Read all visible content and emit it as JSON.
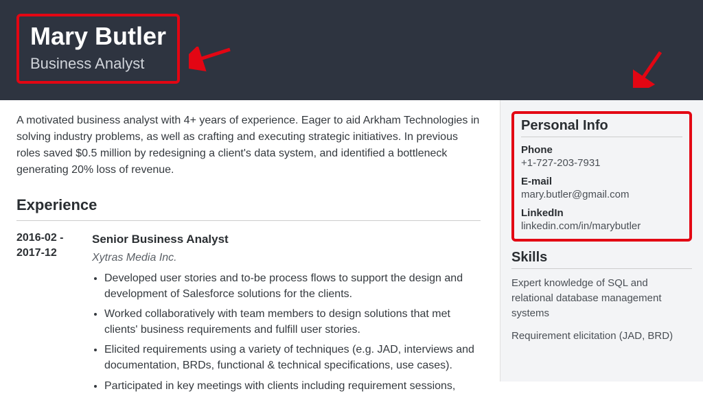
{
  "header": {
    "name": "Mary Butler",
    "title": "Business Analyst"
  },
  "summary": "A motivated business analyst with 4+ years of experience. Eager to aid Arkham Technologies in solving industry problems, as well as crafting and executing strategic initiatives. In previous roles saved $0.5 million by redesigning a client's data system, and identified a bottleneck generating 20% loss of revenue.",
  "sections": {
    "experience_heading": "Experience"
  },
  "experience": {
    "dates": "2016-02 - 2017-12",
    "title": "Senior Business Analyst",
    "company": "Xytras Media Inc.",
    "bullets": [
      "Developed user stories and to-be process flows to support the design and development of Salesforce solutions for the clients.",
      "Worked collaboratively with team members to design solutions that met clients' business requirements and fulfill user stories.",
      "Elicited requirements using a variety of techniques (e.g. JAD, interviews and documentation, BRDs, functional & technical specifications, use cases).",
      "Participated in key meetings with clients including requirement sessions,"
    ]
  },
  "personal": {
    "heading": "Personal Info",
    "phone_label": "Phone",
    "phone_value": "+1-727-203-7931",
    "email_label": "E-mail",
    "email_value": "mary.butler@gmail.com",
    "linkedin_label": "LinkedIn",
    "linkedin_value": "linkedin.com/in/marybutler"
  },
  "skills": {
    "heading": "Skills",
    "items": [
      "Expert knowledge of SQL and relational database management systems",
      "Requirement elicitation (JAD, BRD)"
    ]
  }
}
